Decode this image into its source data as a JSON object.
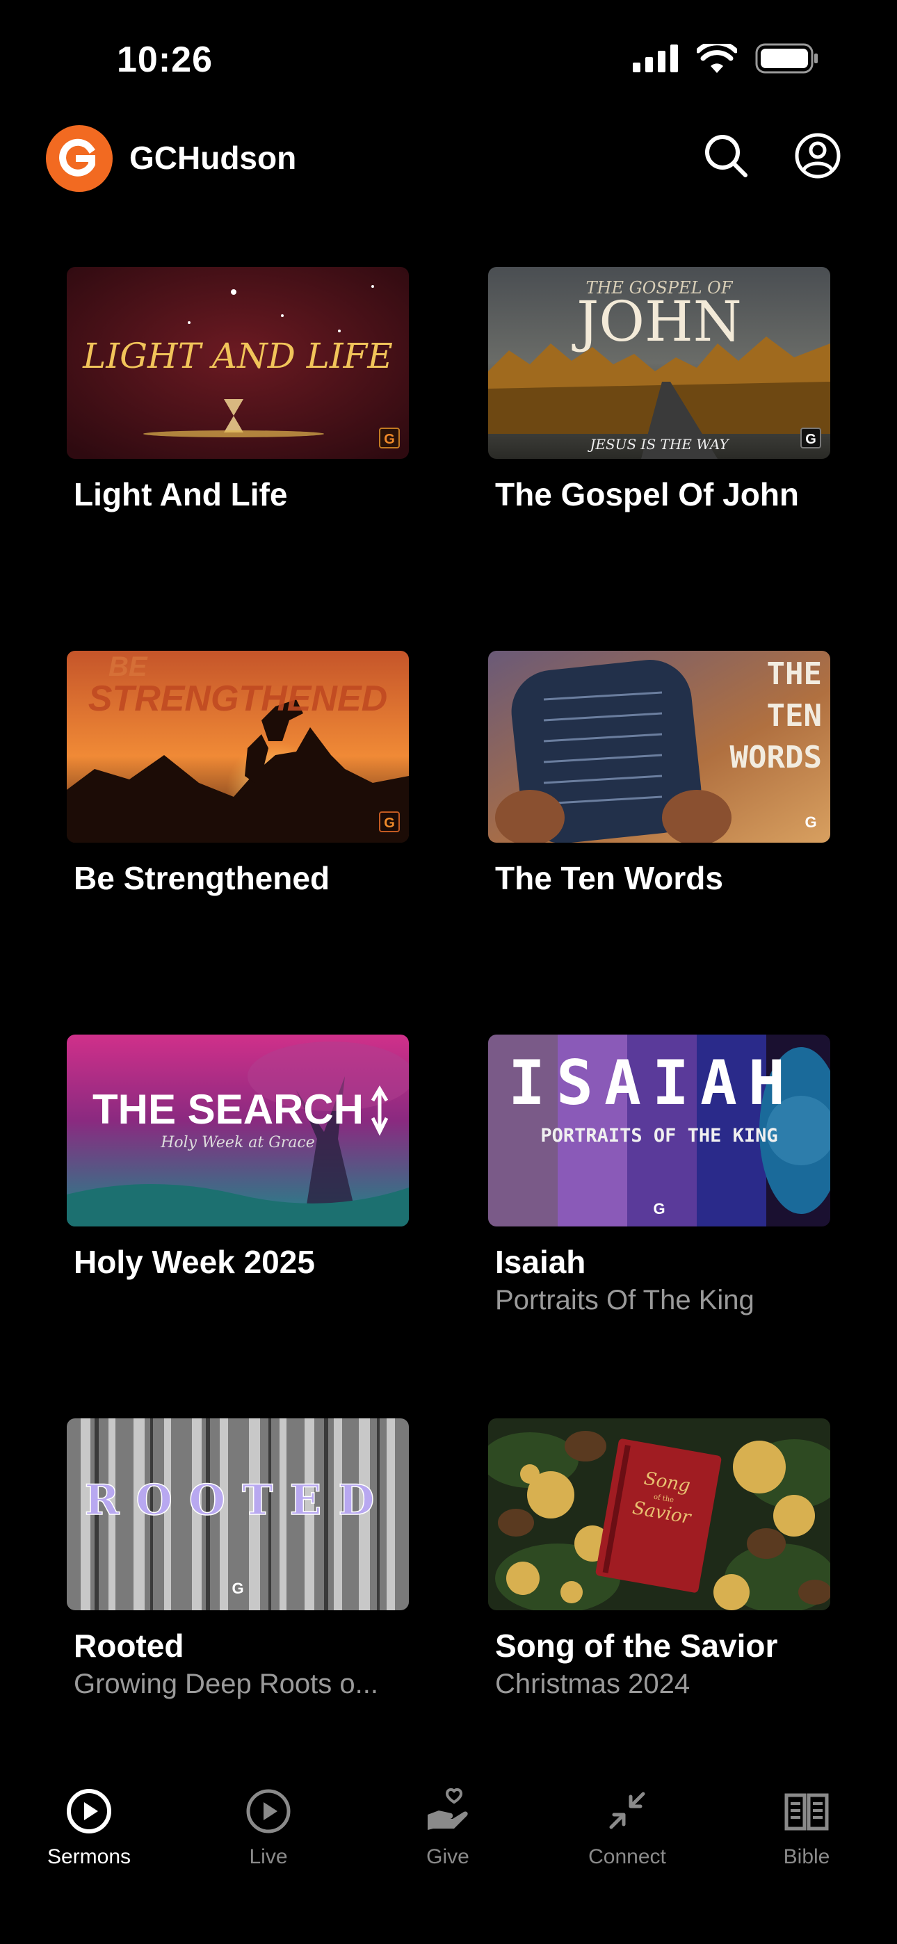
{
  "status_bar": {
    "time": "10:26"
  },
  "header": {
    "app_name": "GCHudson",
    "logo_letter": "G"
  },
  "series": [
    {
      "title": "Light And Life",
      "subtitle": "",
      "art_text": "LIGHT AND LIFE"
    },
    {
      "title": "The Gospel Of John",
      "subtitle": "",
      "art_text": "JOHN",
      "art_kicker": "THE GOSPEL OF",
      "art_tagline": "JESUS IS THE WAY"
    },
    {
      "title": "Be Strengthened",
      "subtitle": "",
      "art_text": "STRENGTHENED",
      "art_kicker": "BE"
    },
    {
      "title": "The Ten Words",
      "subtitle": "",
      "art_lines": [
        "THE",
        "TEN",
        "WORDS"
      ]
    },
    {
      "title": "Holy Week 2025",
      "subtitle": "",
      "art_text": "THE SEARCH",
      "art_tagline": "Holy Week at Grace"
    },
    {
      "title": "Isaiah",
      "subtitle": "Portraits Of The King",
      "art_text": "ISAIAH",
      "art_tagline": "PORTRAITS OF THE KING"
    },
    {
      "title": "Rooted",
      "subtitle": "Growing Deep Roots o...",
      "art_text": "ROOTED"
    },
    {
      "title": "Song of the Savior",
      "subtitle": "Christmas 2024",
      "art_lines": [
        "Song",
        "of the",
        "Savior"
      ]
    }
  ],
  "tabs": [
    {
      "label": "Sermons",
      "icon": "play-circle-icon",
      "active": true
    },
    {
      "label": "Live",
      "icon": "play-circle-icon",
      "active": false
    },
    {
      "label": "Give",
      "icon": "heart-hand-icon",
      "active": false
    },
    {
      "label": "Connect",
      "icon": "arrows-in-icon",
      "active": false
    },
    {
      "label": "Bible",
      "icon": "open-book-icon",
      "active": false
    }
  ],
  "colors": {
    "brand": "#f26a21",
    "background": "#000000",
    "subtitle": "#9a9a9a",
    "tab_inactive": "#8a8a8a"
  }
}
